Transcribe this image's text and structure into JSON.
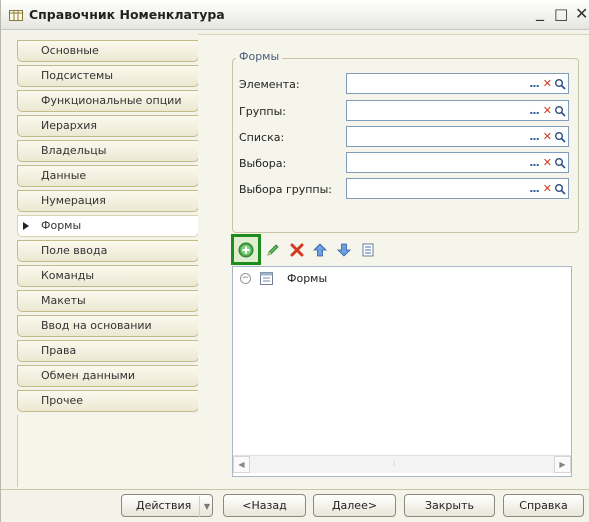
{
  "window": {
    "title": "Справочник Номенклатура",
    "controls": {
      "minimize": "_",
      "maximize": "□",
      "close": "✕"
    }
  },
  "sidebar": {
    "active_index": 7,
    "items": [
      {
        "label": "Основные"
      },
      {
        "label": "Подсистемы"
      },
      {
        "label": "Функциональные опции"
      },
      {
        "label": "Иерархия"
      },
      {
        "label": "Владельцы"
      },
      {
        "label": "Данные"
      },
      {
        "label": "Нумерация"
      },
      {
        "label": "Формы"
      },
      {
        "label": "Поле ввода"
      },
      {
        "label": "Команды"
      },
      {
        "label": "Макеты"
      },
      {
        "label": "Ввод на основании"
      },
      {
        "label": "Права"
      },
      {
        "label": "Обмен данными"
      },
      {
        "label": "Прочее"
      }
    ]
  },
  "forms_group": {
    "title": "Формы",
    "fields": [
      {
        "label": "Элемента:",
        "value": ""
      },
      {
        "label": "Группы:",
        "value": ""
      },
      {
        "label": "Списка:",
        "value": ""
      },
      {
        "label": "Выбора:",
        "value": ""
      },
      {
        "label": "Выбора группы:",
        "value": ""
      }
    ],
    "field_buttons": {
      "select": "...",
      "clear": "✕"
    }
  },
  "toolbar": {
    "icons": [
      "add-icon",
      "edit-pencil-icon",
      "delete-icon",
      "move-up-icon",
      "move-down-icon",
      "properties-icon"
    ]
  },
  "tree": {
    "root_label": "Формы",
    "expander": "−"
  },
  "footer": {
    "actions": "Действия",
    "back": "<Назад",
    "next": "Далее>",
    "close": "Закрыть",
    "help": "Справка"
  },
  "colors": {
    "highlight_border": "#1e8c1e",
    "delete_red": "#d23a1e",
    "arrow_blue": "#3a7bd5"
  }
}
